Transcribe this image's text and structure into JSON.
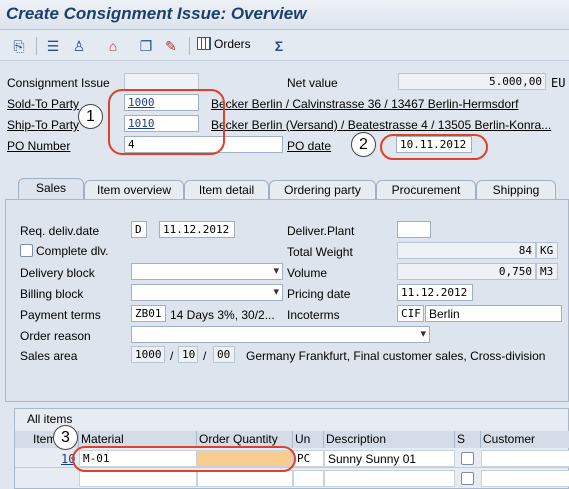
{
  "window": {
    "title": "Create Consignment Issue: Overview"
  },
  "toolbar": {
    "orders_label": "Orders"
  },
  "header": {
    "consignment_issue_label": "Consignment Issue",
    "consignment_issue_value": "",
    "net_value_label": "Net value",
    "net_value": "5.000,00",
    "currency": "EU",
    "sold_to_label": "Sold-To Party",
    "sold_to_value": "1000",
    "sold_to_desc": "Becker Berlin / Calvinstrasse 36 / 13467 Berlin-Hermsdorf",
    "ship_to_label": "Ship-To Party",
    "ship_to_value": "1010",
    "ship_to_desc": "Becker Berlin (Versand) / Beatestrasse 4 / 13505 Berlin-Konra...",
    "po_number_label": "PO Number",
    "po_number_value": "4",
    "po_date_label": "PO date",
    "po_date_value": "10.11.2012"
  },
  "callouts": [
    "1",
    "2",
    "3"
  ],
  "tabs": [
    "Sales",
    "Item overview",
    "Item detail",
    "Ordering party",
    "Procurement",
    "Shipping"
  ],
  "sales": {
    "req_deliv_label": "Req. deliv.date",
    "req_deliv_type": "D",
    "req_deliv_value": "11.12.2012",
    "deliver_plant_label": "Deliver.Plant",
    "complete_dlv_label": "Complete dlv.",
    "total_weight_label": "Total Weight",
    "total_weight_value": "84",
    "total_weight_unit": "KG",
    "delivery_block_label": "Delivery block",
    "volume_label": "Volume",
    "volume_value": "0,750",
    "volume_unit": "M3",
    "billing_block_label": "Billing block",
    "pricing_date_label": "Pricing date",
    "pricing_date_value": "11.12.2012",
    "payment_terms_label": "Payment terms",
    "payment_terms_code": "ZB01",
    "payment_terms_desc": "14 Days 3%, 30/2...",
    "incoterms_label": "Incoterms",
    "incoterms_code": "CIF",
    "incoterms_place": "Berlin",
    "order_reason_label": "Order reason",
    "sales_area_label": "Sales area",
    "sales_org": "1000",
    "dist_channel": "10",
    "division": "00",
    "sales_area_desc": "Germany Frankfurt, Final customer sales, Cross-division"
  },
  "items": {
    "title": "All items",
    "columns": [
      "Item",
      "Material",
      "Order Quantity",
      "Un",
      "Description",
      "S",
      "Customer Materi"
    ],
    "rows": [
      {
        "item": "10",
        "material": "M-01",
        "quantity": "",
        "unit": "PC",
        "description": "Sunny Sunny 01"
      }
    ]
  }
}
